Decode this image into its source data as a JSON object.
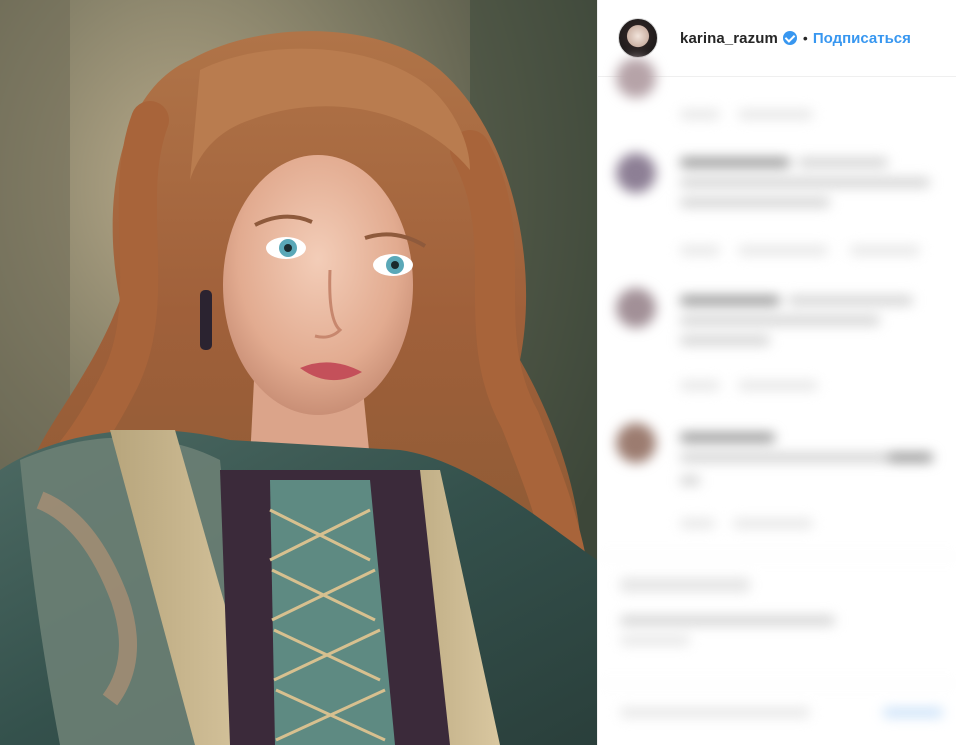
{
  "post": {
    "photo_alt": "",
    "header": {
      "username": "karina_razum",
      "verified": true,
      "separator": "•",
      "follow_label": "Подписаться"
    },
    "comments_blurred": true
  },
  "colors": {
    "accent": "#3897f0",
    "text": "#262626",
    "divider": "#efefef"
  },
  "icons": {
    "verified": "verified-badge-icon"
  }
}
